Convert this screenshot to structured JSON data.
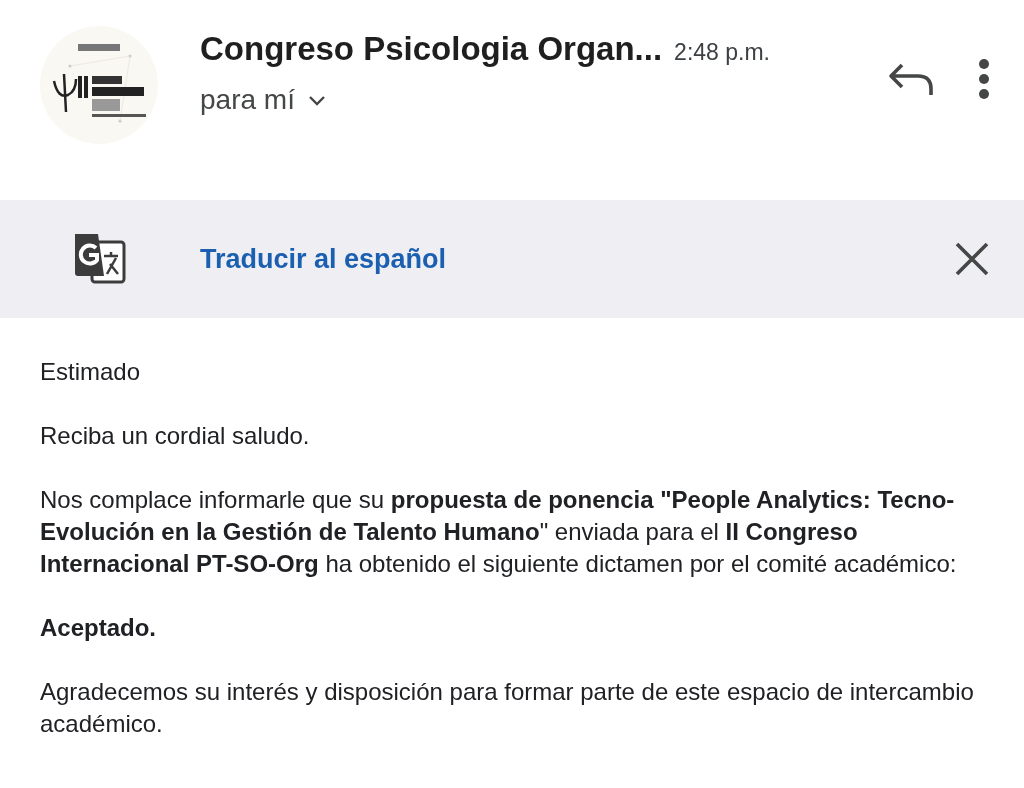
{
  "header": {
    "sender": "Congreso Psicologia Organ...",
    "time": "2:48 p.m.",
    "recipient": "para mí"
  },
  "translate_bar": {
    "label": "Traducir al español"
  },
  "body": {
    "paragraphs": [
      "Estimado",
      "Reciba un cordial saludo.",
      "Nos complace informarle que su **propuesta de ponencia \"People Analytics: Tecno-Evolución en la Gestión de Talento Humano**\" enviada para el **II Congreso Internacional PT-SO-Org** ha obtenido el siguiente dictamen por el comité académico:",
      "**Aceptado.**",
      "Agradecemos su interés y disposición para formar parte de este espacio de intercambio académico."
    ]
  }
}
